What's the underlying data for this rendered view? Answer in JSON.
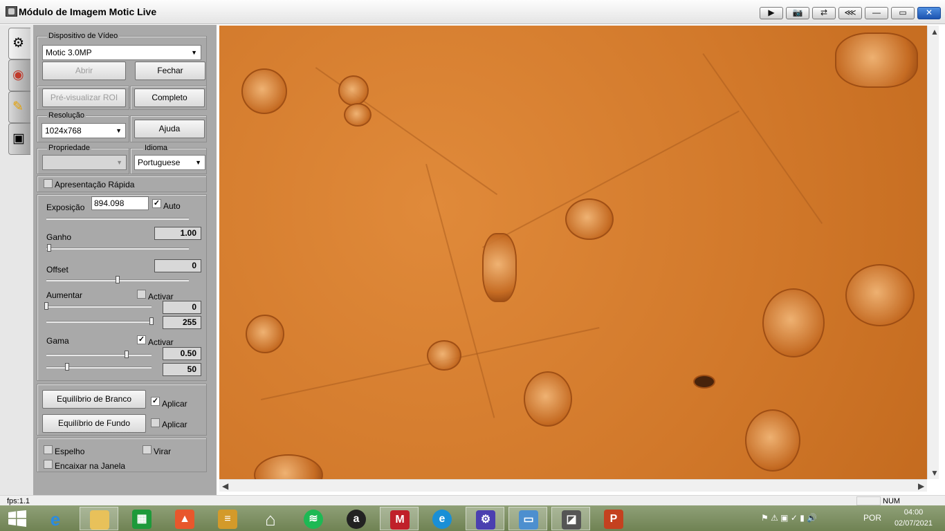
{
  "window": {
    "title": "Módulo de Imagem Motic Live",
    "title_buttons": [
      "▶",
      "📷",
      "⇄",
      "⋘",
      "—",
      "▭",
      "✕"
    ]
  },
  "tabs": [
    {
      "icon": "capture-settings-icon"
    },
    {
      "icon": "color-icon"
    },
    {
      "icon": "tools-icon"
    },
    {
      "icon": "camera-icon"
    }
  ],
  "panel": {
    "device_group": "Dispositivo de Vídeo",
    "device_value": "Motic 3.0MP",
    "open_label": "Abrir",
    "close_label": "Fechar",
    "preview_roi_label": "Pré-visualizar ROI",
    "full_label": "Completo",
    "resolution_group": "Resolução",
    "resolution_value": "1024x768",
    "help_label": "Ajuda",
    "property_group": "Propriedade",
    "property_value": "",
    "language_group": "Idioma",
    "language_value": "Portuguese",
    "quick_present_label": "Apresentação Rápida",
    "quick_present_checked": false,
    "exposure_label": "Exposição",
    "exposure_value": "894.098",
    "exposure_auto_label": "Auto",
    "exposure_auto_checked": true,
    "gain_label": "Ganho",
    "gain_value": "1.00",
    "gain_level": 0.02,
    "offset_label": "Offset",
    "offset_value": "0",
    "offset_level": 0.5,
    "enhance_label": "Aumentar",
    "enhance_activate_label": "Activar",
    "enhance_activate_checked": false,
    "enhance_low_value": "0",
    "enhance_high_value": "255",
    "enhance_low_level": 0.0,
    "enhance_high_level": 1.0,
    "gamma_label": "Gama",
    "gamma_activate_label": "Activar",
    "gamma_activate_checked": true,
    "gamma_value": "0.50",
    "gamma_second_value": "50",
    "gamma_level": 0.76,
    "gamma_second_level": 0.2,
    "white_balance_label": "Equilíbrio de Branco",
    "white_balance_apply_label": "Aplicar",
    "white_balance_apply_checked": true,
    "background_balance_label": "Equilíbrio de Fundo",
    "background_apply_label": "Aplicar",
    "background_apply_checked": false,
    "mirror_label": "Espelho",
    "flip_label": "Virar",
    "fit_window_label": "Encaixar na Janela"
  },
  "status": {
    "fps": "fps:1.1",
    "num": "NUM"
  },
  "taskbar": {
    "items": [
      "ie-icon",
      "file-explorer-icon",
      "store-icon",
      "photos-icon",
      "notes-icon",
      "home-icon",
      "spotify-icon",
      "amazon-icon",
      "app-icon",
      "edge-icon",
      "settings-icon",
      "image-viewer-icon",
      "motic-icon",
      "powerpoint-icon"
    ],
    "language": "POR",
    "time": "04:00",
    "date": "02/07/2021"
  },
  "colors": {
    "panel_bg": "#a9a9a9",
    "image_tint": "#d1782a"
  }
}
